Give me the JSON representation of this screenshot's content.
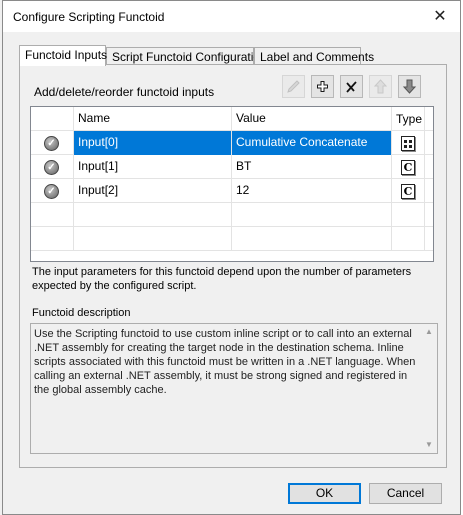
{
  "window": {
    "title": "Configure Scripting Functoid",
    "close_symbol": "✕"
  },
  "tabs": [
    {
      "label": "Functoid Inputs",
      "active": true
    },
    {
      "label": "Script Functoid Configuration",
      "active": false
    },
    {
      "label": "Label and Comments",
      "active": false
    }
  ],
  "inputs_panel": {
    "label": "Add/delete/reorder functoid inputs",
    "toolbar": [
      {
        "name": "edit",
        "icon": "pencil-icon",
        "enabled": false
      },
      {
        "name": "add",
        "icon": "plus-icon",
        "enabled": true
      },
      {
        "name": "delete",
        "icon": "delete-icon",
        "enabled": true
      },
      {
        "name": "move-up",
        "icon": "arrow-up-icon",
        "enabled": false
      },
      {
        "name": "move-down",
        "icon": "arrow-down-icon",
        "enabled": true
      }
    ],
    "columns": [
      "",
      "Name",
      "Value",
      "Type"
    ],
    "rows": [
      {
        "name": "Input[0]",
        "value": "Cumulative Concatenate",
        "type_icon": "functoid-link-icon",
        "selected": true
      },
      {
        "name": "Input[1]",
        "value": "BT",
        "type_icon": "constant-icon",
        "type_glyph": "C",
        "selected": false
      },
      {
        "name": "Input[2]",
        "value": "12",
        "type_icon": "constant-icon",
        "type_glyph": "C",
        "selected": false
      }
    ],
    "help_text": "The input parameters for this functoid depend upon the number of parameters expected by the configured script."
  },
  "description": {
    "label": "Functoid description",
    "text": "Use the Scripting functoid to use custom inline script or to call into an external .NET assembly for creating the target node in the destination schema. Inline scripts associated with this functoid must be written in a .NET language. When calling an external .NET assembly, it must be strong signed and registered in the global assembly cache."
  },
  "buttons": {
    "ok": "OK",
    "cancel": "Cancel"
  },
  "colors": {
    "selection": "#0078d7",
    "accent_plus": "#1a1a1a"
  }
}
